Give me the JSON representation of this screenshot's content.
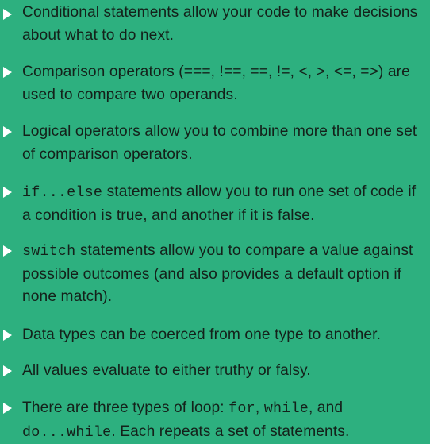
{
  "bullets": [
    {
      "segments": [
        {
          "text": "Conditional statements allow your code to make decisions about what to do next."
        }
      ]
    },
    {
      "segments": [
        {
          "text": "Comparison operators (===, !==, ==, !=, <, >, <=, =>) are used to compare two operands."
        }
      ]
    },
    {
      "segments": [
        {
          "text": "Logical operators allow you to combine more than one set of comparison operators."
        }
      ]
    },
    {
      "segments": [
        {
          "text": "if...else",
          "code": true
        },
        {
          "text": " statements allow you to run one set of code if a condition is true, and another if it is false."
        }
      ]
    },
    {
      "segments": [
        {
          "text": "switch",
          "code": true
        },
        {
          "text": " statements allow you to compare a value against possible outcomes (and also provides a default option if none match)."
        }
      ]
    },
    {
      "segments": [
        {
          "text": "Data types can be coerced from one type to another."
        }
      ]
    },
    {
      "segments": [
        {
          "text": "All values evaluate to either truthy or falsy."
        }
      ]
    },
    {
      "segments": [
        {
          "text": "There are three types of loop: "
        },
        {
          "text": "for",
          "code": true
        },
        {
          "text": ", "
        },
        {
          "text": "while",
          "code": true
        },
        {
          "text": ", and "
        },
        {
          "text": "do...while",
          "code": true
        },
        {
          "text": ". Each repeats a set of statements."
        }
      ]
    }
  ]
}
